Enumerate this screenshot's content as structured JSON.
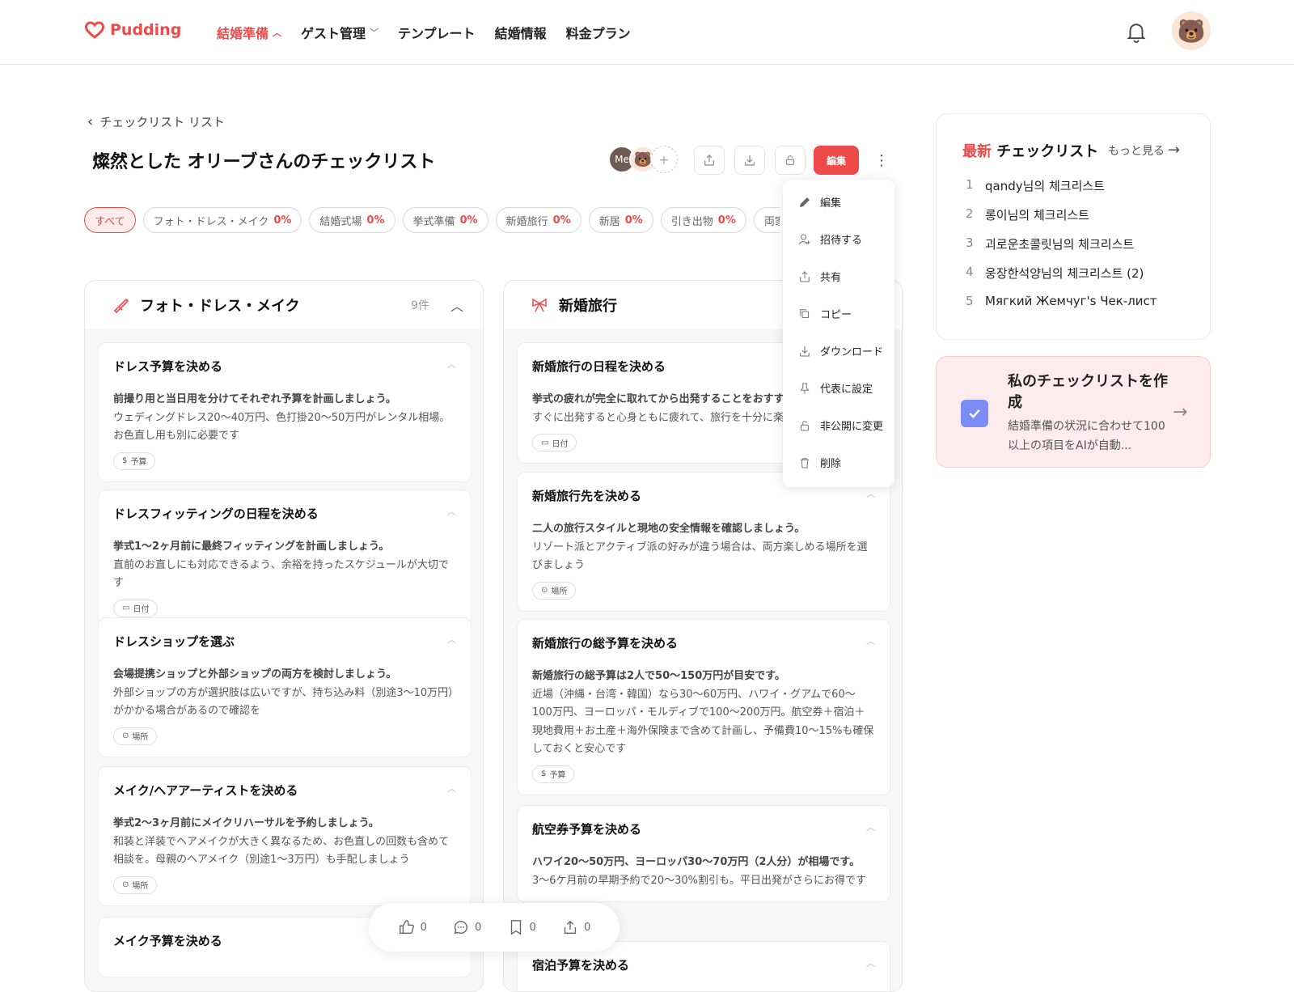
{
  "app": {
    "name": "Pudding",
    "brand_color": "#ef4a4a"
  },
  "nav": [
    {
      "label": "結婚準備",
      "active": true,
      "dropdown": true
    },
    {
      "label": "ゲスト管理",
      "active": false,
      "dropdown": true
    },
    {
      "label": "テンプレート",
      "active": false,
      "dropdown": false
    },
    {
      "label": "結婚情報",
      "active": false,
      "dropdown": false
    },
    {
      "label": "料金プラン",
      "active": false,
      "dropdown": false
    }
  ],
  "breadcrumb": {
    "back_label": "チェックリスト リスト"
  },
  "page": {
    "title": "燦然とした オリーブさんのチェックリスト"
  },
  "members": {
    "me_label": "Me",
    "add_label": "+"
  },
  "toolbar": {
    "edit_label": "編集",
    "more_label": "⋮"
  },
  "filters": [
    {
      "label": "すべて",
      "pct": "",
      "active": true
    },
    {
      "label": "フォト・ドレス・メイク",
      "pct": "0%"
    },
    {
      "label": "結婚式場",
      "pct": "0%"
    },
    {
      "label": "挙式準備",
      "pct": "0%"
    },
    {
      "label": "新婚旅行",
      "pct": "0%"
    },
    {
      "label": "新居",
      "pct": "0%"
    },
    {
      "label": "引き出物",
      "pct": "0%"
    },
    {
      "label": "両家顔合わせ",
      "pct": ""
    }
  ],
  "columns": {
    "left": {
      "title": "フォト・ドレス・メイク",
      "count": "9件",
      "cards": [
        {
          "title": "ドレス予算を決める",
          "lead": "前撮り用と当日用を分けてそれぞれ予算を計画しましょう。",
          "body": "ウェディングドレス20～40万円、色打掛20～50万円がレンタル相場。お色直し用も別に必要です",
          "tag": "予算"
        },
        {
          "title": "ドレスフィッティングの日程を決める",
          "lead": "挙式1～2ヶ月前に最終フィッティングを計画しましょう。",
          "body": "直前のお直しにも対応できるよう、余裕を持ったスケジュールが大切です",
          "tag": "日付"
        },
        {
          "title": "ドレスショップを選ぶ",
          "lead": "会場提携ショップと外部ショップの両方を検討しましょう。",
          "body": "外部ショップの方が選択肢は広いですが、持ち込み料（別途3～10万円）がかかる場合があるので確認を",
          "tag": "場所"
        },
        {
          "title": "メイク/ヘアアーティストを決める",
          "lead": "挙式2～3ヶ月前にメイクリハーサルを予約しましょう。",
          "body": "和装と洋装でヘアメイクが大きく異なるため、お色直しの回数も含めて相談を。母親のヘアメイク（別途1～3万円）も手配しましょう",
          "tag": "場所"
        },
        {
          "title": "メイク予算を決める",
          "lead": "",
          "body": "",
          "tag": ""
        }
      ]
    },
    "right": {
      "title": "新婚旅行",
      "cards": [
        {
          "title": "新婚旅行の日程を決める",
          "lead": "挙式の疲れが完全に取れてから出発することをおすすめ",
          "body": "すぐに出発すると心身ともに疲れて、旅行を十分に楽し",
          "tag": "日付"
        },
        {
          "title": "新婚旅行先を決める",
          "lead": "二人の旅行スタイルと現地の安全情報を確認しましょう。",
          "body": "リゾート派とアクティブ派の好みが違う場合は、両方楽しめる場所を選びましょう",
          "tag": "場所"
        },
        {
          "title": "新婚旅行の総予算を決める",
          "lead": "新婚旅行の総予算は2人で50～150万円が目安です。",
          "body": "近場（沖縄・台湾・韓国）なら30～60万円、ハワイ・グアムで60～100万円、ヨーロッパ・モルディブで100～200万円。航空券＋宿泊＋現地費用＋お土産＋海外保険まで含めて計画し、予備費10～15%も確保しておくと安心です",
          "tag": "予算"
        },
        {
          "title": "航空券予算を決める",
          "lead": "ハワイ20～50万円、ヨーロッパ30～70万円（2人分）が相場です。",
          "body": "3～6ケ月前の早期予約で20～30%割引も。平日出発がさらにお得です",
          "tag": ""
        },
        {
          "title": "宿泊予算を決める",
          "lead": "",
          "body": "",
          "tag": ""
        }
      ]
    }
  },
  "menu": [
    {
      "label": "編集",
      "icon": "pencil-icon"
    },
    {
      "label": "招待する",
      "icon": "person-add-icon"
    },
    {
      "label": "共有",
      "icon": "share-icon"
    },
    {
      "label": "コピー",
      "icon": "copy-icon"
    },
    {
      "label": "ダウンロード",
      "icon": "download-icon"
    },
    {
      "label": "代表に設定",
      "icon": "pin-icon"
    },
    {
      "label": "非公開に変更",
      "icon": "lock-icon"
    },
    {
      "label": "削除",
      "icon": "trash-icon"
    }
  ],
  "latest": {
    "title_accent": "最新",
    "title_rest": " チェックリスト",
    "more_label": "もっと見る",
    "items": [
      {
        "rank": "1",
        "name": "qandy님의 체크리스트"
      },
      {
        "rank": "2",
        "name": "롱이님의 체크리스트"
      },
      {
        "rank": "3",
        "name": "괴로운초콜릿님의 체크리스트"
      },
      {
        "rank": "4",
        "name": "웅장한석양님의 체크리스트 (2)"
      },
      {
        "rank": "5",
        "name": "Мягкий Жемчуг's Чек-лист"
      }
    ]
  },
  "create_card": {
    "title": "私のチェックリストを作成",
    "desc": "結婚準備の状況に合わせて100以上の項目をAIが自動..."
  },
  "float_bar": {
    "likes": "0",
    "comments": "0",
    "bookmarks": "0",
    "shares": "0"
  }
}
